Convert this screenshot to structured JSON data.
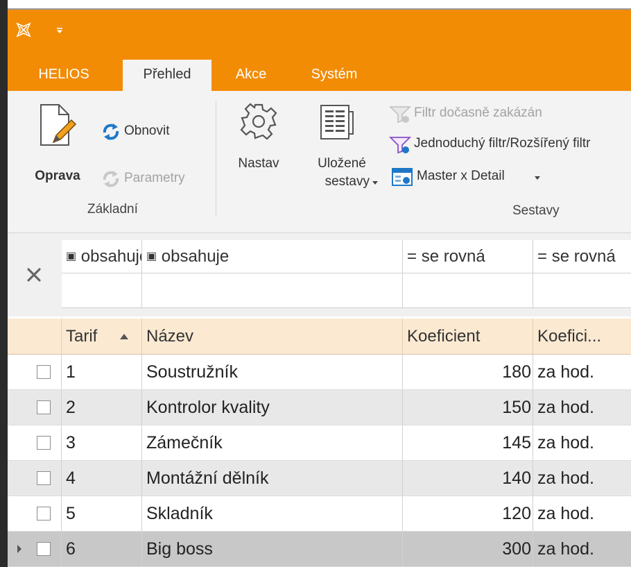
{
  "tabs": [
    {
      "label": "HELIOS"
    },
    {
      "label": "Přehled"
    },
    {
      "label": "Akce"
    },
    {
      "label": "Systém"
    }
  ],
  "ribbon": {
    "oprava": "Oprava",
    "obnovit": "Obnovit",
    "parametry": "Parametry",
    "group_zakladni": "Základní",
    "nastav": "Nastav",
    "ulozene_line1": "Uložené",
    "ulozene_line2": "sestavy",
    "filtr_docasne": "Filtr dočasně zakázán",
    "jednoduchy_filtr": "Jednoduchý filtr/Rozšířený filtr",
    "master_detail": "Master x Detail",
    "group_sestavy": "Sestavy"
  },
  "filter": {
    "tarif_op": "obsahuje",
    "nazev_op": "obsahuje",
    "koef_op": "se rovná",
    "koef_typ_op": "se rovná",
    "tarif_value": "",
    "nazev_value": "",
    "koef_value": "",
    "koef_typ_value": ""
  },
  "grid": {
    "columns": {
      "tarif": "Tarif",
      "nazev": "Název",
      "koef": "Koeficient",
      "koef_typ": "Koefici..."
    },
    "rows": [
      {
        "tarif": "1",
        "nazev": "Soustružník",
        "koef": "180",
        "koef_typ": "za hod."
      },
      {
        "tarif": "2",
        "nazev": "Kontrolor kvality",
        "koef": "150",
        "koef_typ": "za hod."
      },
      {
        "tarif": "3",
        "nazev": "Zámečník",
        "koef": "145",
        "koef_typ": "za hod."
      },
      {
        "tarif": "4",
        "nazev": "Montážní dělník",
        "koef": "140",
        "koef_typ": "za hod."
      },
      {
        "tarif": "5",
        "nazev": "Skladník",
        "koef": "120",
        "koef_typ": "za hod."
      },
      {
        "tarif": "6",
        "nazev": "Big boss",
        "koef": "300",
        "koef_typ": "za hod."
      }
    ]
  },
  "colors": {
    "accent": "#f28c05",
    "header_bg": "#fbe9d2",
    "row_alt": "#e8e8e8",
    "row_selected": "#c8c8c8",
    "icon_blue": "#1e78c8"
  },
  "icons": {
    "app": "helios-logo-icon",
    "qat": "quick-access-dropdown-icon",
    "oprava": "edit-document-icon",
    "obnovit": "refresh-icon",
    "parametry": "parameters-icon",
    "nastav": "gear-icon",
    "ulozene": "saved-reports-icon",
    "filter": "filter-icon",
    "master_detail": "master-detail-icon",
    "clear_filter": "close-icon",
    "sort": "sort-ascending-icon"
  }
}
